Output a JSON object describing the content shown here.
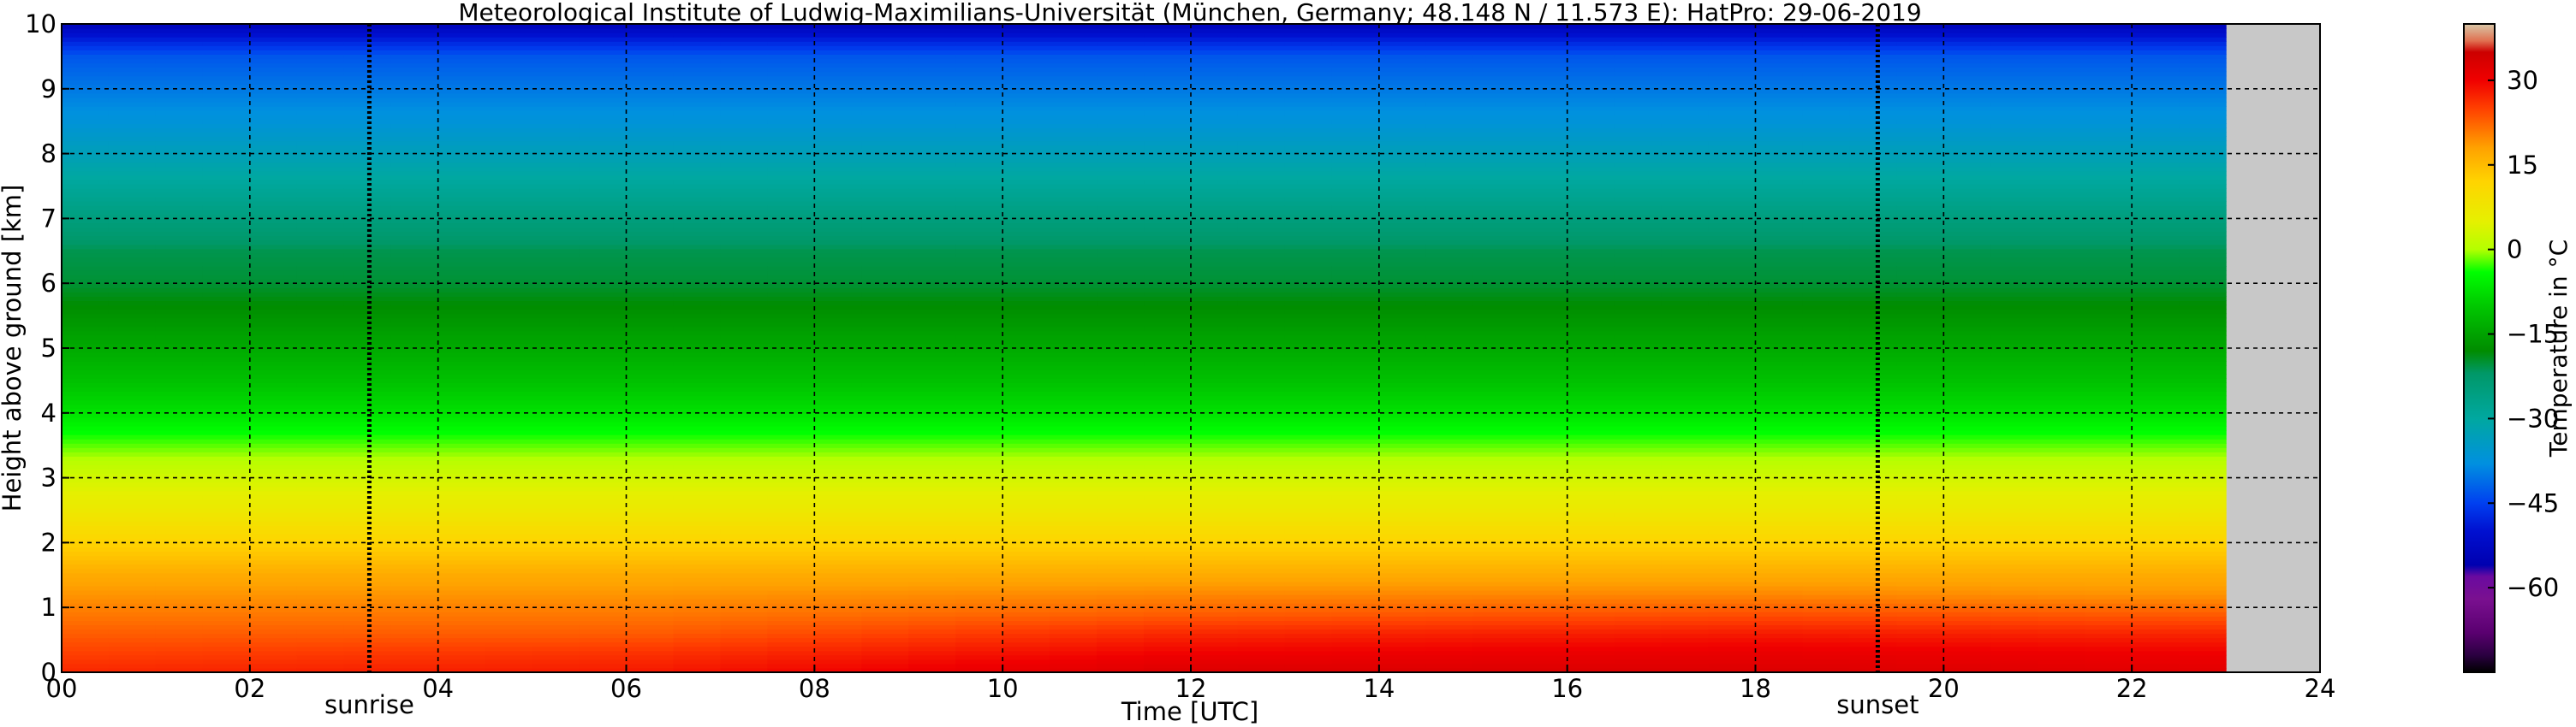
{
  "chart_data": {
    "type": "heatmap",
    "title": "Meteorological Institute of Ludwig-Maximilians-Universität (München, Germany; 48.148 N / 11.573 E):    HatPro: 29-06-2019",
    "xlabel": "Time [UTC]",
    "ylabel": "Height above ground [km]",
    "xlim": [
      0,
      24
    ],
    "ylim": [
      0,
      10
    ],
    "x_ticks": [
      "00",
      "02",
      "04",
      "06",
      "08",
      "10",
      "12",
      "14",
      "16",
      "18",
      "20",
      "22",
      "24"
    ],
    "y_ticks": [
      "0",
      "1",
      "2",
      "3",
      "4",
      "5",
      "6",
      "7",
      "8",
      "9",
      "10"
    ],
    "grid": true,
    "data_end_hour": 23.0,
    "markers": [
      {
        "label": "sunrise",
        "hour": 3.27
      },
      {
        "label": "sunset",
        "hour": 19.3
      }
    ],
    "colorbar": {
      "label": "Temperature in °C",
      "range": [
        -75,
        40
      ],
      "ticks": [
        "30",
        "15",
        "0",
        "−15",
        "−30",
        "−45",
        "−60"
      ],
      "tick_values": [
        30,
        15,
        0,
        -15,
        -30,
        -45,
        -60
      ],
      "stops": [
        {
          "t": -75,
          "color": "#000000"
        },
        {
          "t": -72,
          "color": "#2a0040"
        },
        {
          "t": -68,
          "color": "#5a0070"
        },
        {
          "t": -62,
          "color": "#7a1090"
        },
        {
          "t": -58,
          "color": "#6a0aa0"
        },
        {
          "t": -56,
          "color": "#0000b0"
        },
        {
          "t": -50,
          "color": "#0010d0"
        },
        {
          "t": -45,
          "color": "#0040f0"
        },
        {
          "t": -38,
          "color": "#0090e0"
        },
        {
          "t": -30,
          "color": "#00a8a0"
        },
        {
          "t": -22,
          "color": "#009868"
        },
        {
          "t": -18,
          "color": "#008c00"
        },
        {
          "t": -10,
          "color": "#00c800"
        },
        {
          "t": -4,
          "color": "#00ff00"
        },
        {
          "t": 0,
          "color": "#b4ff00"
        },
        {
          "t": 5,
          "color": "#e6f000"
        },
        {
          "t": 12,
          "color": "#ffd400"
        },
        {
          "t": 18,
          "color": "#ffa200"
        },
        {
          "t": 25,
          "color": "#ff4000"
        },
        {
          "t": 30,
          "color": "#f00000"
        },
        {
          "t": 35,
          "color": "#cc0000"
        },
        {
          "t": 37,
          "color": "#e07050"
        },
        {
          "t": 40,
          "color": "#d8c8a8"
        }
      ]
    },
    "profile_reference": {
      "heights_km": [
        0,
        0.3,
        0.6,
        0.9,
        1.2,
        1.5,
        2.0,
        2.5,
        3.0,
        3.5,
        4.0,
        4.5,
        5.0,
        5.5,
        6.0,
        6.5,
        7.0,
        7.5,
        8.0,
        8.5,
        9.0,
        9.5,
        9.7,
        10.0
      ],
      "times_h": [
        0,
        6,
        12,
        18,
        23
      ],
      "temperatures_c": [
        [
          27,
          28,
          33,
          33,
          32
        ],
        [
          25,
          26,
          30,
          31,
          30
        ],
        [
          23,
          23,
          27,
          28,
          27
        ],
        [
          21,
          21,
          23,
          24,
          23
        ],
        [
          19,
          19,
          20,
          20,
          19
        ],
        [
          17,
          17,
          17,
          17,
          17
        ],
        [
          12,
          12,
          12,
          12,
          12
        ],
        [
          7,
          7,
          7,
          7,
          7
        ],
        [
          3,
          3,
          3,
          3,
          3
        ],
        [
          -2,
          -2,
          -2,
          -2,
          -2
        ],
        [
          -7,
          -7,
          -7,
          -7,
          -7
        ],
        [
          -11,
          -11,
          -11,
          -11,
          -11
        ],
        [
          -14,
          -14,
          -14,
          -14,
          -14
        ],
        [
          -17,
          -17,
          -17,
          -17,
          -17
        ],
        [
          -20,
          -20,
          -20,
          -20,
          -20
        ],
        [
          -21,
          -21,
          -21,
          -21,
          -21
        ],
        [
          -25,
          -25,
          -25,
          -25,
          -25
        ],
        [
          -29,
          -29,
          -29,
          -29,
          -29
        ],
        [
          -33,
          -33,
          -33,
          -33,
          -33
        ],
        [
          -37,
          -37,
          -37,
          -37,
          -37
        ],
        [
          -40,
          -40,
          -40,
          -40,
          -40
        ],
        [
          -43,
          -43,
          -43,
          -43,
          -43
        ],
        [
          -47,
          -47,
          -47,
          -47,
          -47
        ],
        [
          -54,
          -54,
          -54,
          -54,
          -54
        ]
      ]
    }
  }
}
